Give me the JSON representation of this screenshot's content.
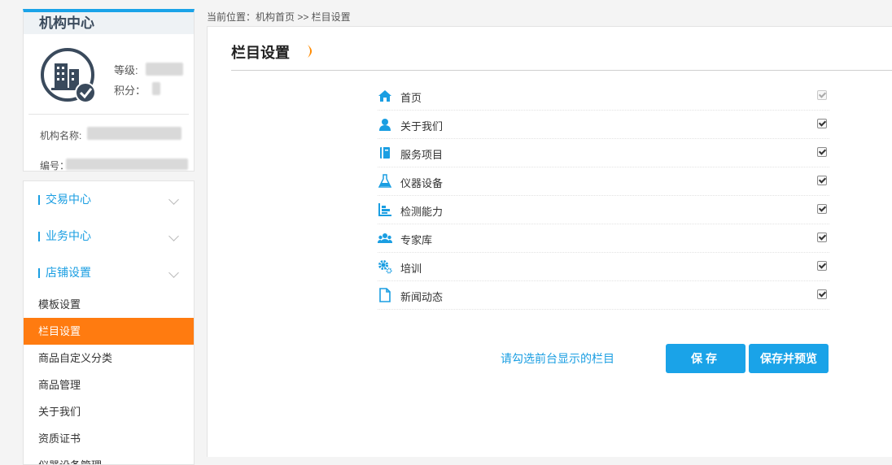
{
  "breadcrumb": "当前位置：机构首页 >> 栏目设置",
  "profile": {
    "title": "机构中心",
    "level_label": "等级:",
    "points_label": "积分：",
    "name_label": "机构名称:",
    "code_label": "编号："
  },
  "nav": {
    "groups": [
      {
        "label": "交易中心"
      },
      {
        "label": "业务中心"
      },
      {
        "label": "店铺设置"
      }
    ],
    "items": [
      {
        "label": "模板设置"
      },
      {
        "label": "栏目设置"
      },
      {
        "label": "商品自定义分类"
      },
      {
        "label": "商品管理"
      },
      {
        "label": "关于我们"
      },
      {
        "label": "资质证书"
      },
      {
        "label": "仪器设备管理"
      }
    ]
  },
  "main": {
    "title": "栏目设置",
    "columns": [
      {
        "label": "首页",
        "icon": "home-icon",
        "checked": true,
        "disabled": true
      },
      {
        "label": "关于我们",
        "icon": "user-icon",
        "checked": true,
        "disabled": false
      },
      {
        "label": "服务项目",
        "icon": "book-icon",
        "checked": true,
        "disabled": false
      },
      {
        "label": "仪器设备",
        "icon": "flask-icon",
        "checked": true,
        "disabled": false
      },
      {
        "label": "检测能力",
        "icon": "bar-chart-icon",
        "checked": true,
        "disabled": false
      },
      {
        "label": "专家库",
        "icon": "group-icon",
        "checked": true,
        "disabled": false
      },
      {
        "label": "培训",
        "icon": "gears-icon",
        "checked": true,
        "disabled": false
      },
      {
        "label": "新闻动态",
        "icon": "document-icon",
        "checked": true,
        "disabled": false
      }
    ],
    "hint": "请勾选前台显示的栏目",
    "save_label": "保存",
    "save_preview_label": "保存并预览"
  },
  "colors": {
    "accent": "#1aa3e8",
    "active_nav": "#ff7b10"
  }
}
